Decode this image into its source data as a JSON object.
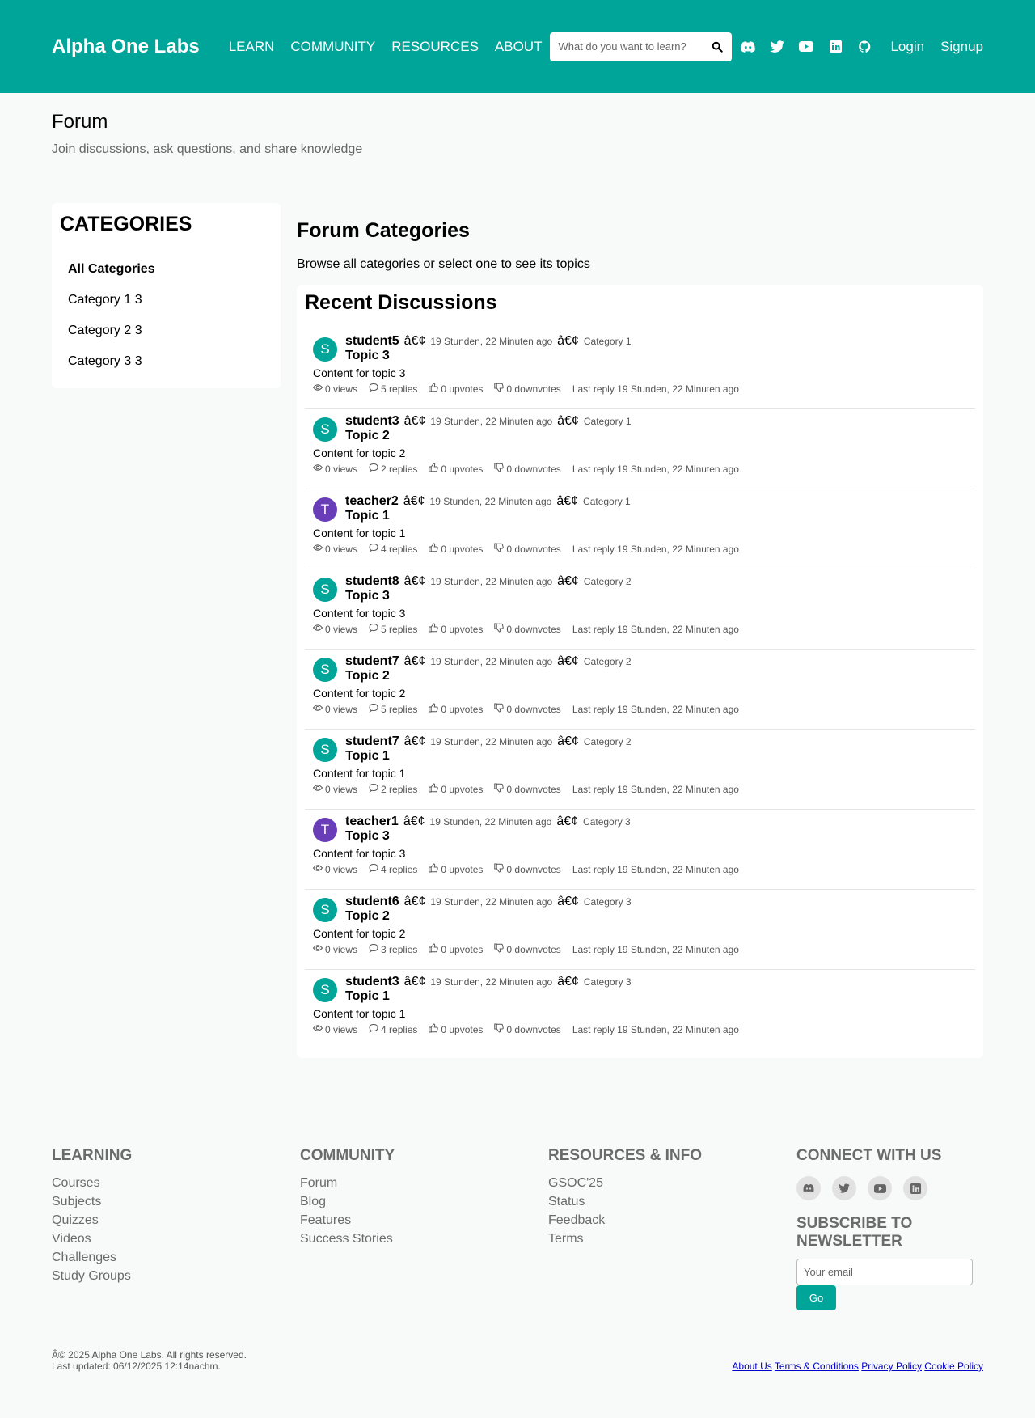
{
  "header": {
    "brand": "Alpha One Labs",
    "nav": [
      "LEARN",
      "COMMUNITY",
      "RESOURCES",
      "ABOUT"
    ],
    "search_placeholder": "What do you want to learn?",
    "login": "Login",
    "signup": "Signup"
  },
  "page": {
    "title": "Forum",
    "subtitle": "Join discussions, ask questions, and share knowledge"
  },
  "sidebar": {
    "heading": "CATEGORIES",
    "items": [
      "All Categories",
      "Category 1 3",
      "Category 2 3",
      "Category 3 3"
    ]
  },
  "main": {
    "heading": "Forum Categories",
    "browse": "Browse all categories or select one to see its topics",
    "recent_heading": "Recent Discussions",
    "separator": "â€¢",
    "topics": [
      {
        "initial": "S",
        "author": "student5",
        "time": "19 Stunden, 22 Minuten ago",
        "category": "Category 1",
        "title": "Topic 3",
        "body": "Content for topic 3",
        "views": "0 views",
        "replies": "5 replies",
        "upvotes": "0 upvotes",
        "downvotes": "0 downvotes",
        "last_reply": "Last reply 19 Stunden, 22 Minuten ago"
      },
      {
        "initial": "S",
        "author": "student3",
        "time": "19 Stunden, 22 Minuten ago",
        "category": "Category 1",
        "title": "Topic 2",
        "body": "Content for topic 2",
        "views": "0 views",
        "replies": "2 replies",
        "upvotes": "0 upvotes",
        "downvotes": "0 downvotes",
        "last_reply": "Last reply 19 Stunden, 22 Minuten ago"
      },
      {
        "initial": "T",
        "author": "teacher2",
        "time": "19 Stunden, 22 Minuten ago",
        "category": "Category 1",
        "title": "Topic 1",
        "body": "Content for topic 1",
        "views": "0 views",
        "replies": "4 replies",
        "upvotes": "0 upvotes",
        "downvotes": "0 downvotes",
        "last_reply": "Last reply 19 Stunden, 22 Minuten ago"
      },
      {
        "initial": "S",
        "author": "student8",
        "time": "19 Stunden, 22 Minuten ago",
        "category": "Category 2",
        "title": "Topic 3",
        "body": "Content for topic 3",
        "views": "0 views",
        "replies": "5 replies",
        "upvotes": "0 upvotes",
        "downvotes": "0 downvotes",
        "last_reply": "Last reply 19 Stunden, 22 Minuten ago"
      },
      {
        "initial": "S",
        "author": "student7",
        "time": "19 Stunden, 22 Minuten ago",
        "category": "Category 2",
        "title": "Topic 2",
        "body": "Content for topic 2",
        "views": "0 views",
        "replies": "5 replies",
        "upvotes": "0 upvotes",
        "downvotes": "0 downvotes",
        "last_reply": "Last reply 19 Stunden, 22 Minuten ago"
      },
      {
        "initial": "S",
        "author": "student7",
        "time": "19 Stunden, 22 Minuten ago",
        "category": "Category 2",
        "title": "Topic 1",
        "body": "Content for topic 1",
        "views": "0 views",
        "replies": "2 replies",
        "upvotes": "0 upvotes",
        "downvotes": "0 downvotes",
        "last_reply": "Last reply 19 Stunden, 22 Minuten ago"
      },
      {
        "initial": "T",
        "author": "teacher1",
        "time": "19 Stunden, 22 Minuten ago",
        "category": "Category 3",
        "title": "Topic 3",
        "body": "Content for topic 3",
        "views": "0 views",
        "replies": "4 replies",
        "upvotes": "0 upvotes",
        "downvotes": "0 downvotes",
        "last_reply": "Last reply 19 Stunden, 22 Minuten ago"
      },
      {
        "initial": "S",
        "author": "student6",
        "time": "19 Stunden, 22 Minuten ago",
        "category": "Category 3",
        "title": "Topic 2",
        "body": "Content for topic 2",
        "views": "0 views",
        "replies": "3 replies",
        "upvotes": "0 upvotes",
        "downvotes": "0 downvotes",
        "last_reply": "Last reply 19 Stunden, 22 Minuten ago"
      },
      {
        "initial": "S",
        "author": "student3",
        "time": "19 Stunden, 22 Minuten ago",
        "category": "Category 3",
        "title": "Topic 1",
        "body": "Content for topic 1",
        "views": "0 views",
        "replies": "4 replies",
        "upvotes": "0 upvotes",
        "downvotes": "0 downvotes",
        "last_reply": "Last reply 19 Stunden, 22 Minuten ago"
      }
    ]
  },
  "footer": {
    "learning": {
      "heading": "LEARNING",
      "links": [
        "Courses",
        "Subjects",
        "Quizzes",
        "Videos",
        "Challenges",
        "Study Groups"
      ]
    },
    "community": {
      "heading": "COMMUNITY",
      "links": [
        "Forum",
        "Blog",
        "Features",
        "Success Stories"
      ]
    },
    "resources": {
      "heading": "RESOURCES & INFO",
      "links": [
        "GSOC'25",
        "Status",
        "Feedback",
        "Terms"
      ]
    },
    "connect": {
      "heading": "CONNECT WITH US",
      "newsletter": "SUBSCRIBE TO NEWSLETTER",
      "email_placeholder": "Your email",
      "go": "Go"
    },
    "copyright": "Â© 2025 Alpha One Labs. All rights reserved.",
    "updated": "Last updated: 06/12/2025 12:14nachm.",
    "bottom_links": [
      "About Us",
      "Terms & Conditions",
      "Privacy Policy",
      "Cookie Policy"
    ]
  },
  "colors": {
    "brand": "#00a599",
    "teacher_avatar": "#6a3db8"
  },
  "icons": [
    "search-icon",
    "discord-icon",
    "twitter-icon",
    "youtube-icon",
    "linkedin-icon",
    "github-icon",
    "eye-icon",
    "comment-icon",
    "thumbs-up-icon",
    "thumbs-down-icon"
  ]
}
